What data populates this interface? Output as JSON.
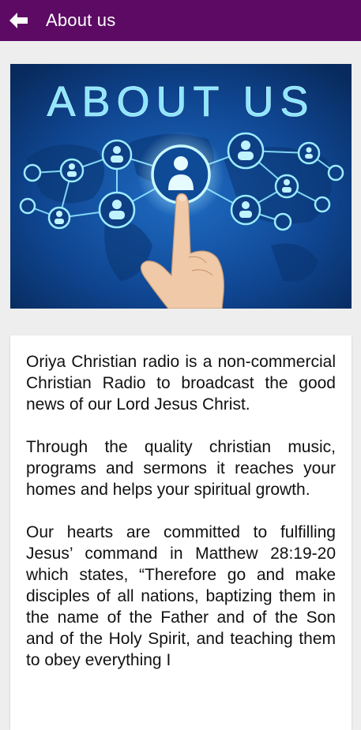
{
  "appbar": {
    "title": "About us",
    "back_icon": "arrow-left-icon",
    "background": "#5c0a63"
  },
  "banner": {
    "heading": "ABOUT US",
    "background": "#0e3e83",
    "accent": "#7ee3ff"
  },
  "content": {
    "paragraphs": [
      "Oriya Christian radio is a non-commercial Christian Radio to broadcast the good news of our Lord Jesus Christ.",
      "Through the quality christian music, programs and sermons it reaches your homes and helps your spiritual growth.",
      "Our hearts are committed to fulfilling Jesus’ command in Matthew 28:19-20 which states, “Therefore go and make disciples of all nations, baptizing them in the name of the Father and of the Son and of the Holy Spirit, and teaching them to obey everything I"
    ]
  }
}
